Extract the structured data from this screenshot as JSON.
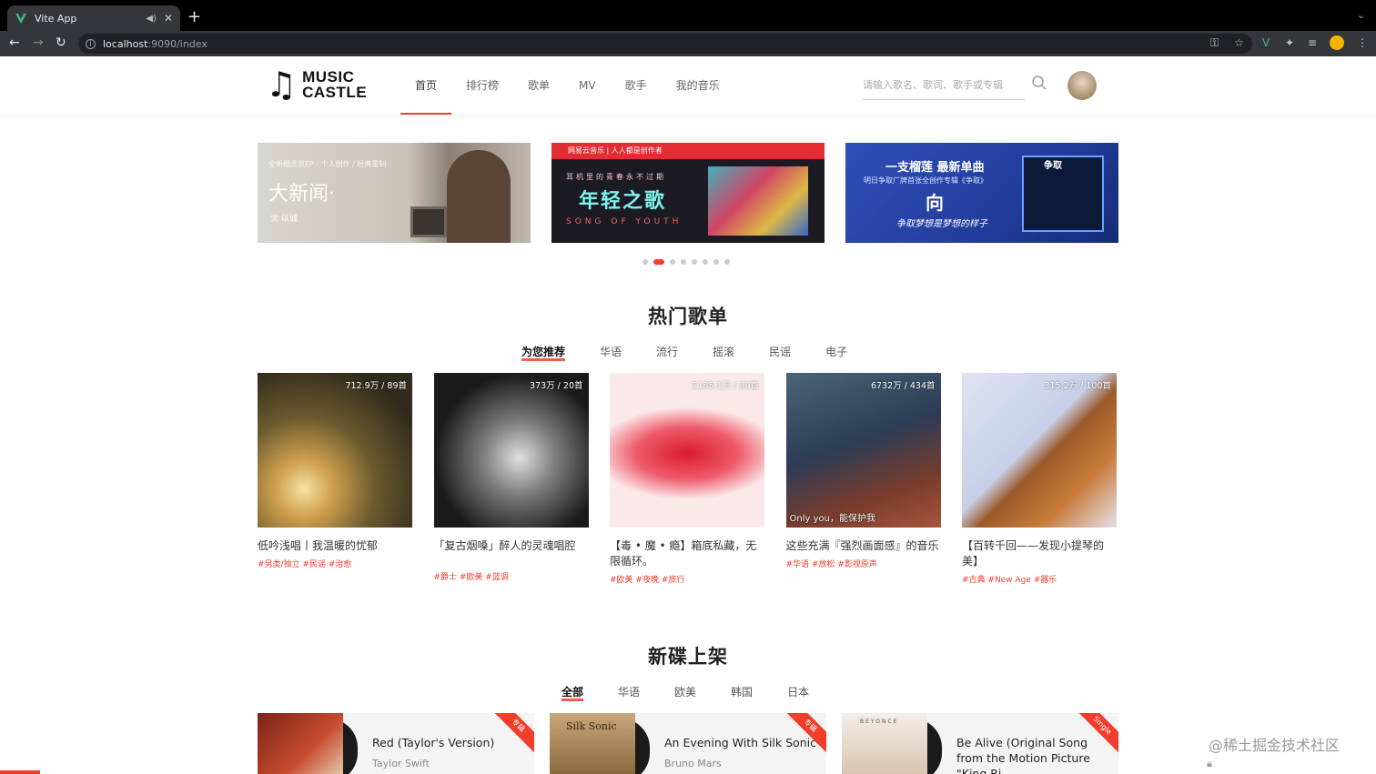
{
  "browser": {
    "tab_title": "Vite App",
    "url_host": "localhost",
    "url_path": ":9090/index"
  },
  "header": {
    "logo_line1": "MUSIC",
    "logo_line2": "CASTLE",
    "nav": [
      "首页",
      "排行榜",
      "歌单",
      "MV",
      "歌手",
      "我的音乐"
    ],
    "active_nav": "首页",
    "search_placeholder": "请输入歌名、歌词、歌手或专辑"
  },
  "banners": [
    {
      "caption_top": "全新概念双EP · 个人创作 / 经典重制",
      "title": "大新闻·",
      "artist": "沈 以诚"
    },
    {
      "topbar": "网易云音乐 | 人人都是创作者",
      "subtitle": "耳机里的青春永不过期",
      "title": "年轻之歌",
      "english": "SONG OF YOUTH"
    },
    {
      "title": "一支榴莲 最新单曲",
      "subtitle": "明日争取厂牌首张全创作专辑《争取》",
      "big": "向",
      "slogan": "争取梦想是梦想的样子",
      "cover_text": "争取"
    }
  ],
  "banner_dots": {
    "count": 8,
    "active_index": 1
  },
  "hot_playlists": {
    "title": "热门歌单",
    "tabs": [
      "为您推荐",
      "华语",
      "流行",
      "摇滚",
      "民谣",
      "电子"
    ],
    "active_tab": "为您推荐",
    "items": [
      {
        "count": "712.9万 / 89首",
        "title": "低吟浅唱丨我温暖的忧郁",
        "tags": "#另类/独立 #民谣 #治愈",
        "overlay": ""
      },
      {
        "count": "373万 / 20首",
        "title": "「复古烟嗓」醉人的灵魂唱腔",
        "tags": "#爵士 #欧美 #蓝调",
        "overlay": ""
      },
      {
        "count": "2185.1万 / 99首",
        "title": "【毒 • 魔 • 瘾】箱底私藏，无限循环。",
        "tags": "#欧美 #夜晚 #旅行",
        "overlay": ""
      },
      {
        "count": "6732万 / 434首",
        "title": "这些充满『强烈画面感』的音乐",
        "tags": "#华语 #放松 #影视原声",
        "overlay": "Only you，能保护我"
      },
      {
        "count": "315.2万 / 100首",
        "title": "【百转千回——发现小提琴的美】",
        "tags": "#古典 #New Age #器乐",
        "overlay": ""
      }
    ]
  },
  "new_albums": {
    "title": "新碟上架",
    "tabs": [
      "全部",
      "华语",
      "欧美",
      "韩国",
      "日本"
    ],
    "active_tab": "全部",
    "items": [
      {
        "name": "Red (Taylor's Version)",
        "artist": "Taylor Swift",
        "ribbon": "专辑",
        "cover_text": ""
      },
      {
        "name": "An Evening With Silk Sonic",
        "artist": "Bruno Mars",
        "ribbon": "专辑",
        "cover_text": "Silk Sonic"
      },
      {
        "name": "Be Alive (Original Song from the Motion Picture \"King Ri",
        "artist": "",
        "ribbon": "Single",
        "cover_text": "BEYONCE"
      }
    ]
  },
  "watermark": "@稀土掘金技术社区",
  "colors": {
    "accent": "#f23d2b",
    "chrome_bg": "#202124"
  }
}
